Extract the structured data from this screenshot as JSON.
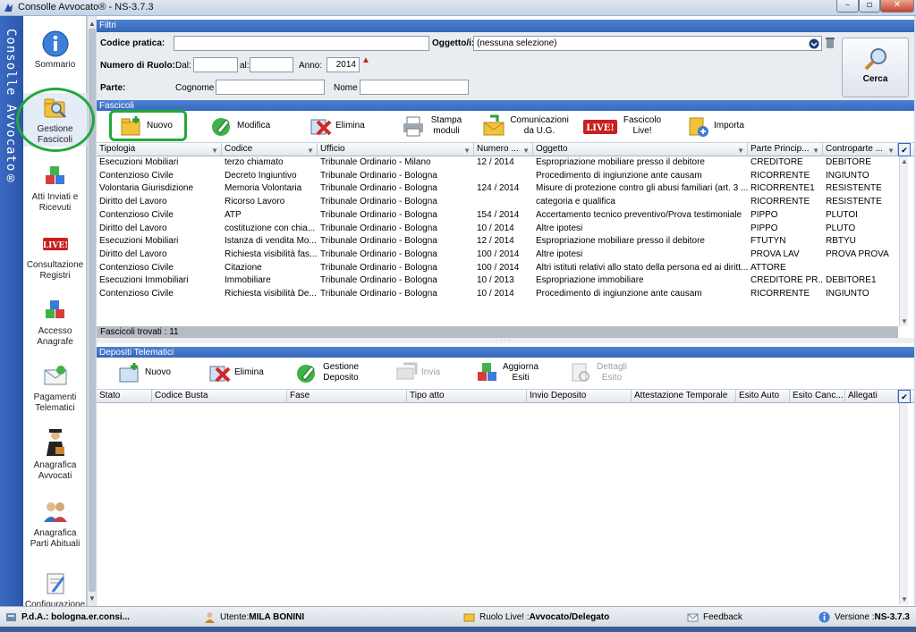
{
  "window": {
    "title": "Consolle Avvocato® - NS-3.7.3",
    "brand_vertical": "Consolle Avvocato®"
  },
  "sidebar": {
    "items": [
      {
        "label": "Sommario",
        "icon": "info-icon"
      },
      {
        "label": "Gestione Fascicoli",
        "icon": "folder-search-icon"
      },
      {
        "label": "Atti Inviati e Ricevuti",
        "icon": "cubes-icon"
      },
      {
        "label": "Consultazione Registri",
        "icon": "live-icon"
      },
      {
        "label": "Accesso Anagrafe",
        "icon": "cubes-icon"
      },
      {
        "label": "Pagamenti Telematici",
        "icon": "envelope-icon"
      },
      {
        "label": "Anagrafica Avvocati",
        "icon": "lawyer-icon"
      },
      {
        "label": "Anagrafica Parti Abituali",
        "icon": "people-icon"
      },
      {
        "label": "Configurazione",
        "icon": "config-icon"
      }
    ]
  },
  "filters": {
    "header": "Filtri",
    "codice_pratica_label": "Codice pratica:",
    "codice_pratica_value": "",
    "oggetto_label": "Oggetto/i:",
    "oggetto_value": "(nessuna selezione)",
    "numero_ruolo_label": "Numero di Ruolo:",
    "dal_label": "Dal:",
    "dal_value": "",
    "al_label": "al:",
    "al_value": "",
    "anno_label": "Anno:",
    "anno_value": "2014",
    "parte_label": "Parte:",
    "cognome_label": "Cognome",
    "cognome_value": "",
    "nome_label": "Nome",
    "nome_value": "",
    "cerca_label": "Cerca"
  },
  "fascicoli": {
    "header": "Fascicoli",
    "toolbar": {
      "nuovo": "Nuovo",
      "modifica": "Modifica",
      "elimina": "Elimina",
      "stampa": "Stampa moduli",
      "comunicazioni": "Comunicazioni da U.G.",
      "live": "Fascicolo Live!",
      "importa": "Importa"
    },
    "columns": [
      "Tipologia",
      "Codice",
      "Ufficio",
      "Numero ...",
      "Oggetto",
      "Parte Princip...",
      "Controparte ..."
    ],
    "rows": [
      [
        "Esecuzioni Mobiliari",
        "terzo chiamato",
        "Tribunale Ordinario - Milano",
        "12 / 2014",
        "Espropriazione mobiliare presso il debitore",
        "CREDITORE",
        "DEBITORE"
      ],
      [
        "Contenzioso Civile",
        "Decreto Ingiuntivo",
        "Tribunale Ordinario - Bologna",
        "",
        "Procedimento di ingiunzione ante causam",
        "RICORRENTE",
        "INGIUNTO"
      ],
      [
        "Volontaria Giurisdizione",
        "Memoria Volontaria",
        "Tribunale Ordinario - Bologna",
        "124 / 2014",
        "Misure di protezione contro gli abusi familiari (art. 3 ...",
        "RICORRENTE1",
        "RESISTENTE"
      ],
      [
        "Diritto del Lavoro",
        "Ricorso Lavoro",
        "Tribunale Ordinario - Bologna",
        "",
        "categoria e qualifica",
        "RICORRENTE",
        "RESISTENTE"
      ],
      [
        "Contenzioso Civile",
        "ATP",
        "Tribunale Ordinario - Bologna",
        "154 / 2014",
        "Accertamento tecnico preventivo/Prova testimoniale",
        "PIPPO",
        "PLUTOI"
      ],
      [
        "Diritto del Lavoro",
        "costituzione con chia...",
        "Tribunale Ordinario - Bologna",
        "10 / 2014",
        "Altre ipotesi",
        "PIPPO",
        "PLUTO"
      ],
      [
        "Esecuzioni Mobiliari",
        "Istanza di vendita Mo...",
        "Tribunale Ordinario - Bologna",
        "12 / 2014",
        "Espropriazione mobiliare presso il debitore",
        "FTUTYN",
        "RBTYU"
      ],
      [
        "Diritto del Lavoro",
        "Richiesta visibilità fas...",
        "Tribunale Ordinario - Bologna",
        "100 / 2014",
        "Altre ipotesi",
        "PROVA LAV",
        "PROVA PROVA"
      ],
      [
        "Contenzioso Civile",
        "Citazione",
        "Tribunale Ordinario - Bologna",
        "100 / 2014",
        "Altri istituti relativi allo stato della persona ed ai diritt...",
        "ATTORE",
        ""
      ],
      [
        "Esecuzioni Immobiliari",
        "Immobiliare",
        "Tribunale Ordinario - Bologna",
        "10 / 2013",
        "Espropriazione immobiliare",
        "CREDITORE PR...",
        "DEBITORE1"
      ],
      [
        "Contenzioso Civile",
        "Richiesta visibilità De...",
        "Tribunale Ordinario - Bologna",
        "10 / 2014",
        "Procedimento di ingiunzione ante causam",
        "RICORRENTE",
        "INGIUNTO"
      ]
    ],
    "found_label": "Fascicoli trovati :  11"
  },
  "depositi": {
    "header": "Depositi Telematici",
    "toolbar": {
      "nuovo": "Nuovo",
      "elimina": "Elimina",
      "gestione": "Gestione Deposito",
      "invia": "Invia",
      "aggiorna": "Aggiorna Esiti",
      "dettagli": "Dettagli Esito"
    },
    "columns": [
      "Stato",
      "Codice Busta",
      "Fase",
      "Tipo atto",
      "Invio Deposito",
      "Attestazione Temporale",
      "Esito Auto",
      "Esito Canc...",
      "Allegati"
    ]
  },
  "statusbar": {
    "pda": "P.d.A.: bologna.er.consi...",
    "utente_label": "Utente: ",
    "utente_value": "MILA BONINI",
    "ruolo_label": "Ruolo Live! : ",
    "ruolo_value": "Avvocato/Delegato",
    "feedback": "Feedback",
    "versione_label": "Versione : ",
    "versione_value": "NS-3.7.3"
  }
}
